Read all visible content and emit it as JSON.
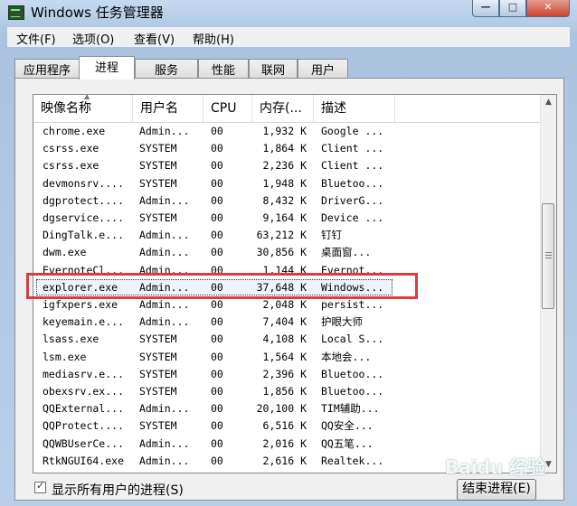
{
  "window": {
    "title": "Windows 任务管理器"
  },
  "menu": [
    "文件(F)",
    "选项(O)",
    "查看(V)",
    "帮助(H)"
  ],
  "tabs": [
    "应用程序",
    "进程",
    "服务",
    "性能",
    "联网",
    "用户"
  ],
  "active_tab": "进程",
  "columns": [
    "映像名称",
    "用户名",
    "CPU",
    "内存(...",
    "描述"
  ],
  "processes": [
    {
      "name": "chrome.exe",
      "user": "Admin...",
      "cpu": "00",
      "mem": "1,932 K",
      "desc": "Google ..."
    },
    {
      "name": "csrss.exe",
      "user": "SYSTEM",
      "cpu": "00",
      "mem": "1,864 K",
      "desc": "Client ..."
    },
    {
      "name": "csrss.exe",
      "user": "SYSTEM",
      "cpu": "00",
      "mem": "2,236 K",
      "desc": "Client ..."
    },
    {
      "name": "devmonsrv....",
      "user": "SYSTEM",
      "cpu": "00",
      "mem": "1,948 K",
      "desc": "Bluetoo..."
    },
    {
      "name": "dgprotect....",
      "user": "Admin...",
      "cpu": "00",
      "mem": "8,432 K",
      "desc": "DriverG..."
    },
    {
      "name": "dgservice....",
      "user": "SYSTEM",
      "cpu": "00",
      "mem": "9,164 K",
      "desc": "Device ..."
    },
    {
      "name": "DingTalk.e...",
      "user": "Admin...",
      "cpu": "00",
      "mem": "63,212 K",
      "desc": "钉钉"
    },
    {
      "name": "dwm.exe",
      "user": "Admin...",
      "cpu": "00",
      "mem": "30,856 K",
      "desc": "桌面窗..."
    },
    {
      "name": "EvernoteCl...",
      "user": "Admin...",
      "cpu": "00",
      "mem": "1,144 K",
      "desc": "Evernot..."
    },
    {
      "name": "explorer.exe",
      "user": "Admin...",
      "cpu": "00",
      "mem": "37,648 K",
      "desc": "Windows..."
    },
    {
      "name": "igfxpers.exe",
      "user": "Admin...",
      "cpu": "00",
      "mem": "2,048 K",
      "desc": "persist..."
    },
    {
      "name": "keyemain.e...",
      "user": "Admin...",
      "cpu": "00",
      "mem": "7,404 K",
      "desc": "护眼大师"
    },
    {
      "name": "lsass.exe",
      "user": "SYSTEM",
      "cpu": "00",
      "mem": "4,108 K",
      "desc": "Local S..."
    },
    {
      "name": "lsm.exe",
      "user": "SYSTEM",
      "cpu": "00",
      "mem": "1,564 K",
      "desc": "本地会..."
    },
    {
      "name": "mediasrv.e...",
      "user": "SYSTEM",
      "cpu": "00",
      "mem": "2,396 K",
      "desc": "Bluetoo..."
    },
    {
      "name": "obexsrv.ex...",
      "user": "SYSTEM",
      "cpu": "00",
      "mem": "1,856 K",
      "desc": "Bluetoo..."
    },
    {
      "name": "QQExternal...",
      "user": "Admin...",
      "cpu": "00",
      "mem": "20,100 K",
      "desc": "TIM辅助..."
    },
    {
      "name": "QQProtect....",
      "user": "SYSTEM",
      "cpu": "00",
      "mem": "6,516 K",
      "desc": "QQ安全..."
    },
    {
      "name": "QQWBUserCe...",
      "user": "Admin...",
      "cpu": "00",
      "mem": "2,016 K",
      "desc": "QQ五笔..."
    },
    {
      "name": "RtkNGUI64.exe",
      "user": "Admin...",
      "cpu": "00",
      "mem": "2,616 K",
      "desc": "Realtek..."
    }
  ],
  "selected_index": 9,
  "footer": {
    "show_all_label": "显示所有用户的进程(S)",
    "show_all_checked": true,
    "end_process_label": "结束进程(E)"
  },
  "watermark": "Baidu 经验"
}
